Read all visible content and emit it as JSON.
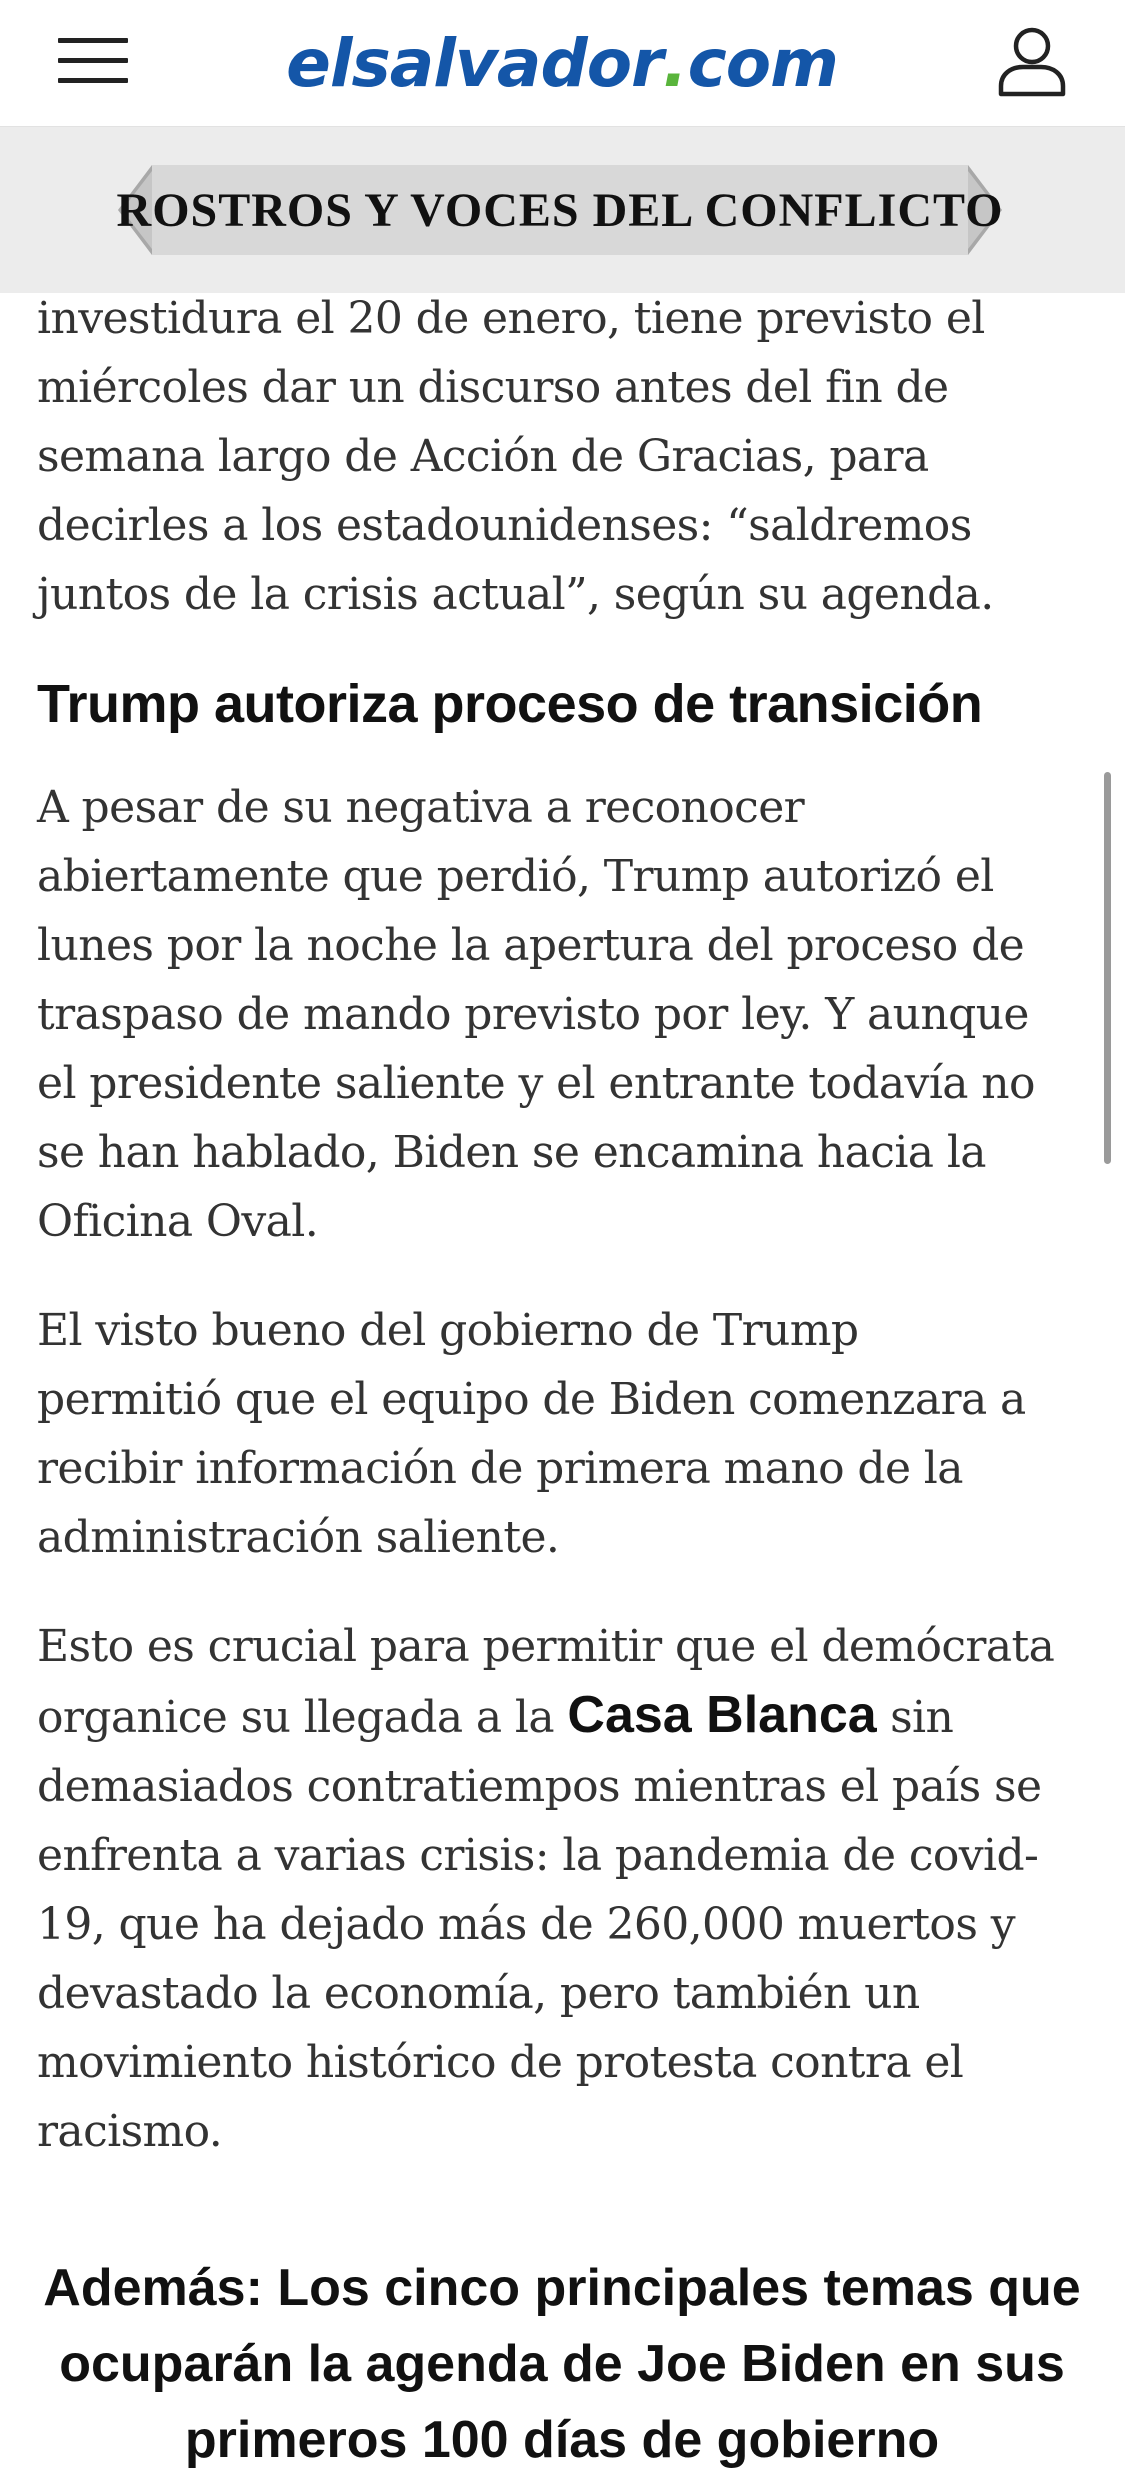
{
  "header": {
    "menu_icon": "hamburger-menu-icon",
    "logo": {
      "main": "elsalvador",
      "dot": ".",
      "tld": "com"
    },
    "user_icon": "user-profile-icon",
    "colors": {
      "brand_blue": "#1456a8",
      "brand_green": "#59b43b"
    }
  },
  "banner": {
    "title": "ROSTROS Y VOCES DEL CONFLICTO"
  },
  "article": {
    "para1": {
      "lines": [
        "investidura el 20 de enero, tiene previsto el",
        "miércoles dar un discurso antes del fin de",
        "semana largo de Acción de Gracias, para",
        "decirles a los estadounidenses: “saldremos",
        "juntos de la crisis actual”, según su agenda."
      ]
    },
    "subheading": "Trump autoriza proceso de transición",
    "para2": {
      "lines": [
        "A pesar de su negativa a reconocer",
        "abiertamente que perdió, Trump autorizó el",
        "lunes por la noche la apertura del proceso de",
        "traspaso de mando previsto por ley. Y aunque",
        "el presidente saliente y el entrante todavía no",
        "se han hablado, Biden se encamina hacia la",
        "Oficina Oval."
      ]
    },
    "para3": {
      "lines": [
        "El visto bueno del gobierno de Trump",
        "permitió que el equipo de Biden comenzara a",
        "recibir información de primera mano de la",
        "administración saliente."
      ]
    },
    "para4": {
      "line1": "Esto es crucial para permitir que el demócrata",
      "line2_before": "organice su llegada a la ",
      "link": "Casa Blanca",
      "line2_after": " sin",
      "rest": [
        "demasiados contratiempos mientras el país se",
        "enfrenta a varias crisis: la pandemia de covid-",
        "19, que ha dejado más de 260,000 muertos y",
        "devastado la economía, pero también un",
        "movimiento histórico de protesta contra el",
        "racismo."
      ]
    },
    "related": {
      "lines": [
        "Además: Los cinco principales temas que",
        "ocuparán la agenda de Joe Biden en sus",
        "primeros 100 días de gobierno"
      ]
    }
  }
}
